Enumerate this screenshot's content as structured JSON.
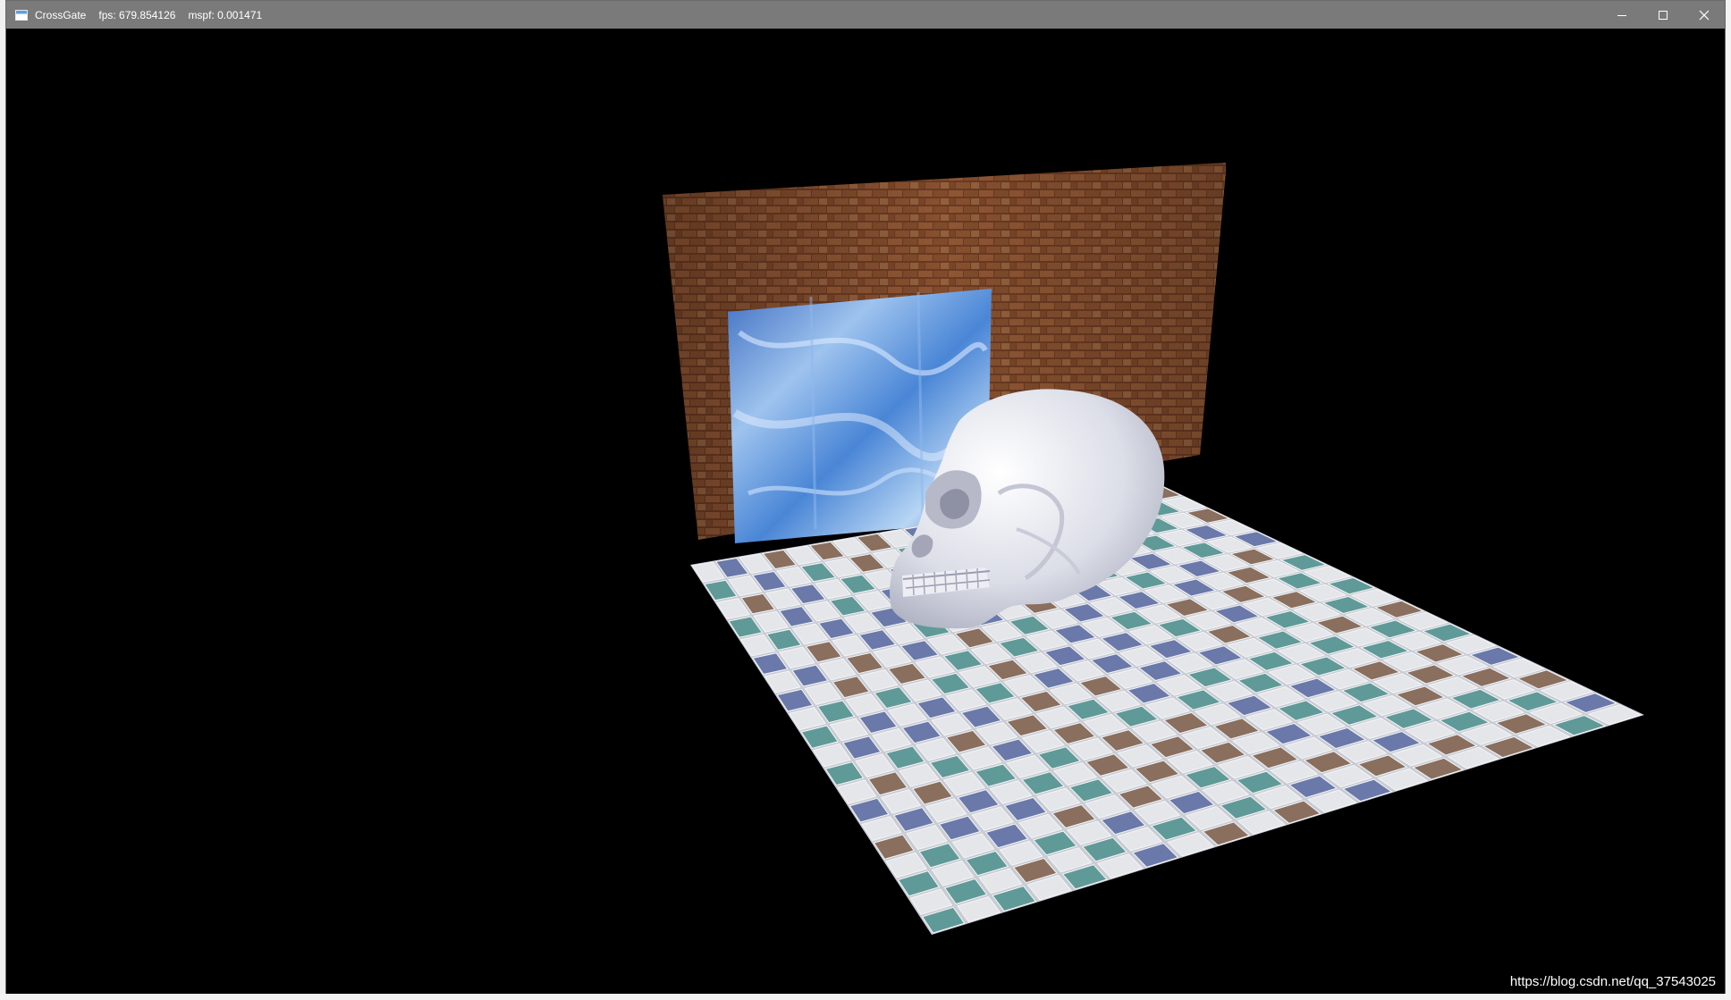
{
  "window": {
    "app_name": "CrossGate",
    "fps_label": "fps: 679.854126",
    "mspf_label": "mspf: 0.001471",
    "minimize_icon": "minimize-icon",
    "maximize_icon": "maximize-icon",
    "close_icon": "close-icon"
  },
  "scene": {
    "background_color": "#000000",
    "wall_texture": "brick",
    "mirror_texture": "water-ice",
    "floor_texture": "checker-tiles",
    "object": "skull",
    "tile_colors": [
      "#e4e6ea",
      "#6a79aa",
      "#5f9a98",
      "#8a6f5e"
    ],
    "watermark": "https://blog.csdn.net/qq_37543025"
  }
}
